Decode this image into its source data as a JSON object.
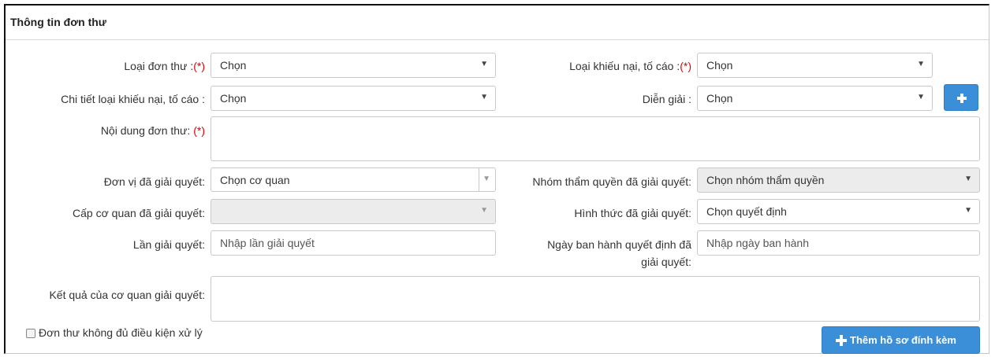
{
  "panel": {
    "title": "Thông tin đơn thư"
  },
  "required_mark": "(*)",
  "fields": {
    "loai_don_thu": {
      "label": "Loại đơn thư :",
      "value": "Chọn"
    },
    "loai_khieu_nai": {
      "label": "Loại khiếu nại, tố cáo :",
      "value": "Chọn"
    },
    "chi_tiet": {
      "label": "Chi tiết loại khiếu nại, tố cáo :",
      "value": "Chọn"
    },
    "dien_giai": {
      "label": "Diễn giải :",
      "value": "Chọn"
    },
    "noi_dung": {
      "label": "Nội dung đơn thư:",
      "value": ""
    },
    "don_vi": {
      "label": "Đơn vị đã giải quyết:",
      "value": "Chọn cơ quan"
    },
    "nhom_tham_quyen": {
      "label": "Nhóm thẩm quyền đã giải quyết:",
      "value": "Chọn nhóm thẩm quyền"
    },
    "cap_co_quan": {
      "label": "Cấp cơ quan đã giải quyết:",
      "value": ""
    },
    "hinh_thuc": {
      "label": "Hình thức đã giải quyết:",
      "value": "Chọn quyết định"
    },
    "lan_giai_quyet": {
      "label": "Lần giải quyết:",
      "placeholder": "Nhập lần giải quyết"
    },
    "ngay_ban_hanh": {
      "label_line1": "Ngày ban hành quyết định đã",
      "label_line2": "giải quyết:",
      "placeholder": "Nhập ngày ban hành"
    },
    "ket_qua": {
      "label": "Kết quả của cơ quan giải quyết:",
      "value": ""
    }
  },
  "checkbox": {
    "label": "Đơn thư không đủ điều kiện xử lý",
    "checked": false
  },
  "buttons": {
    "add": {
      "icon": "plus-icon",
      "glyph": "+"
    },
    "attach": {
      "icon": "plus-icon",
      "label": "Thêm hồ sơ đính kèm"
    }
  },
  "colors": {
    "primary": "#3a8fd8",
    "required": "#e00000",
    "disabled_bg": "#ececec"
  }
}
